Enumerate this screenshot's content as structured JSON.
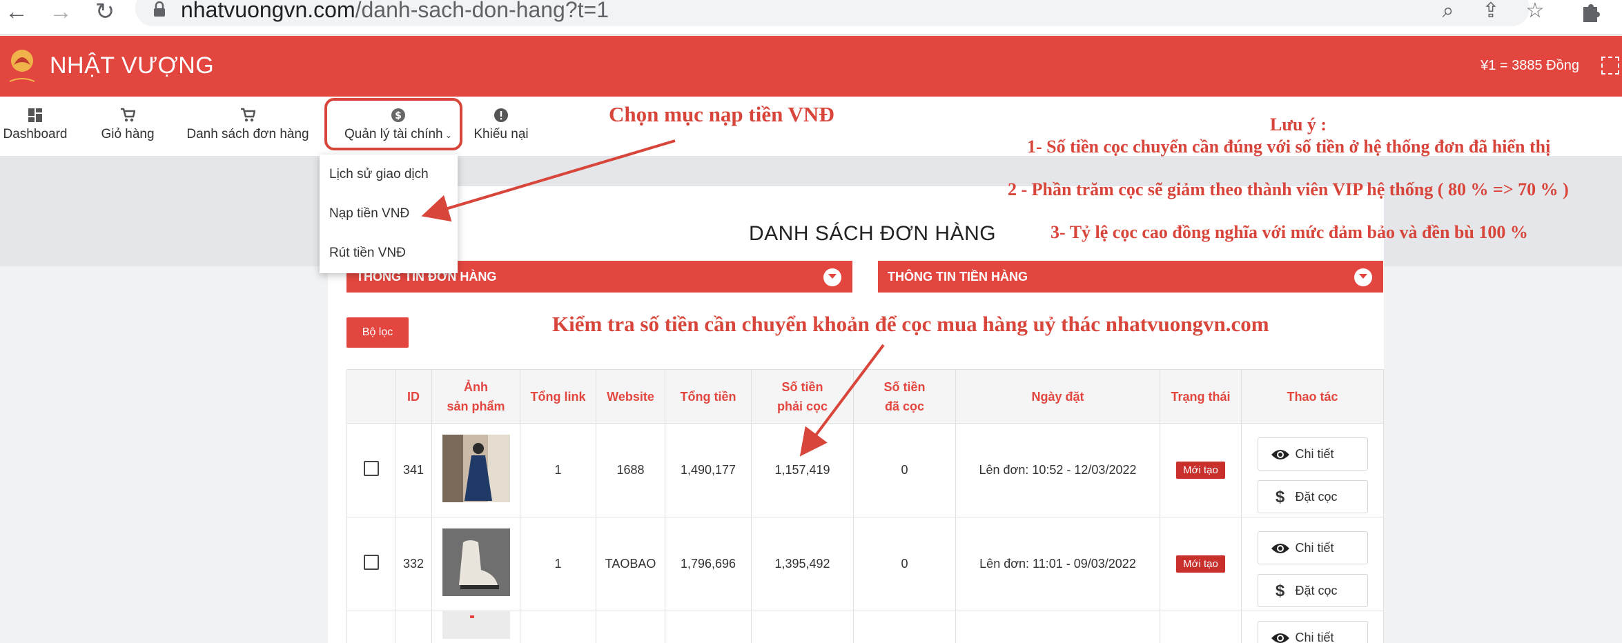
{
  "browser": {
    "url_host": "nhatvuongvn.com",
    "url_path": "/danh-sach-don-hang?t=1",
    "back_glyph": "←",
    "forward_glyph": "→",
    "reload_glyph": "↻",
    "zoom_glyph": "⌕",
    "share_glyph": "⇪",
    "star_glyph": "☆"
  },
  "header": {
    "brand": "NHẬT VƯỢNG",
    "exchange_rate": "¥1 = 3885 Đồng",
    "accent_color": "#e2463f"
  },
  "menu": {
    "items": [
      {
        "label": "Dashboard",
        "icon": "dashboard-icon"
      },
      {
        "label": "Giỏ hàng",
        "icon": "cart-icon"
      },
      {
        "label": "Danh sách đơn hàng",
        "icon": "cart-icon"
      },
      {
        "label": "Quản lý tài chính",
        "icon": "dollar-circle-icon"
      },
      {
        "label": "Khiếu nại",
        "icon": "alert-circle-icon"
      }
    ],
    "dropdown": [
      "Lịch sử giao dịch",
      "Nạp tiền VNĐ",
      "Rút tiền VNĐ"
    ]
  },
  "page": {
    "title": "DANH SÁCH ĐƠN HÀNG",
    "panel_order_info": "THÔNG TIN ĐƠN HÀNG",
    "panel_money_info": "THÔNG TIN TIỀN HÀNG",
    "filter_button": "Bộ lọc"
  },
  "table": {
    "headers": {
      "id": "ID",
      "image_1": "Ảnh",
      "image_2": "sản phẩm",
      "links": "Tổng link",
      "website": "Website",
      "total": "Tổng tiền",
      "deposit_required_1": "Số tiền",
      "deposit_required_2": "phải cọc",
      "deposit_paid_1": "Số tiền",
      "deposit_paid_2": "đã cọc",
      "date": "Ngày đặt",
      "status": "Trạng thái",
      "actions": "Thao tác"
    },
    "rows": [
      {
        "id": "341",
        "links": "1",
        "website": "1688",
        "total": "1,490,177",
        "deposit_required": "1,157,419",
        "deposit_paid": "0",
        "date": "Lên đơn: 10:52 - 12/03/2022",
        "status": "Mới tạo",
        "detail": "Chi tiết",
        "deposit": "Đặt cọc"
      },
      {
        "id": "332",
        "links": "1",
        "website": "TAOBAO",
        "total": "1,796,696",
        "deposit_required": "1,395,492",
        "deposit_paid": "0",
        "date": "Lên đơn: 11:01 - 09/03/2022",
        "status": "Mới tạo",
        "detail": "Chi tiết",
        "deposit": "Đặt cọc"
      },
      {
        "detail": "Chi tiết"
      }
    ]
  },
  "annotations": {
    "choose": "Chọn mục nạp tiền VNĐ",
    "note_title": "Lưu ý :",
    "note_1": "1- Số tiền cọc chuyển cần đúng với số tiền ở hệ thống đơn đã hiển thị",
    "note_2": "2 - Phần trăm cọc sẽ giảm theo thành viên VIP hệ thống ( 80 % => 70 % )",
    "note_3": "3- Tỷ lệ cọc cao đồng nghĩa với mức đảm bảo và đền bù 100 %",
    "check": "Kiểm tra số tiền cần chuyển khoản để cọc mua hàng uỷ thác nhatvuongvn.com",
    "color": "#d8453b"
  }
}
